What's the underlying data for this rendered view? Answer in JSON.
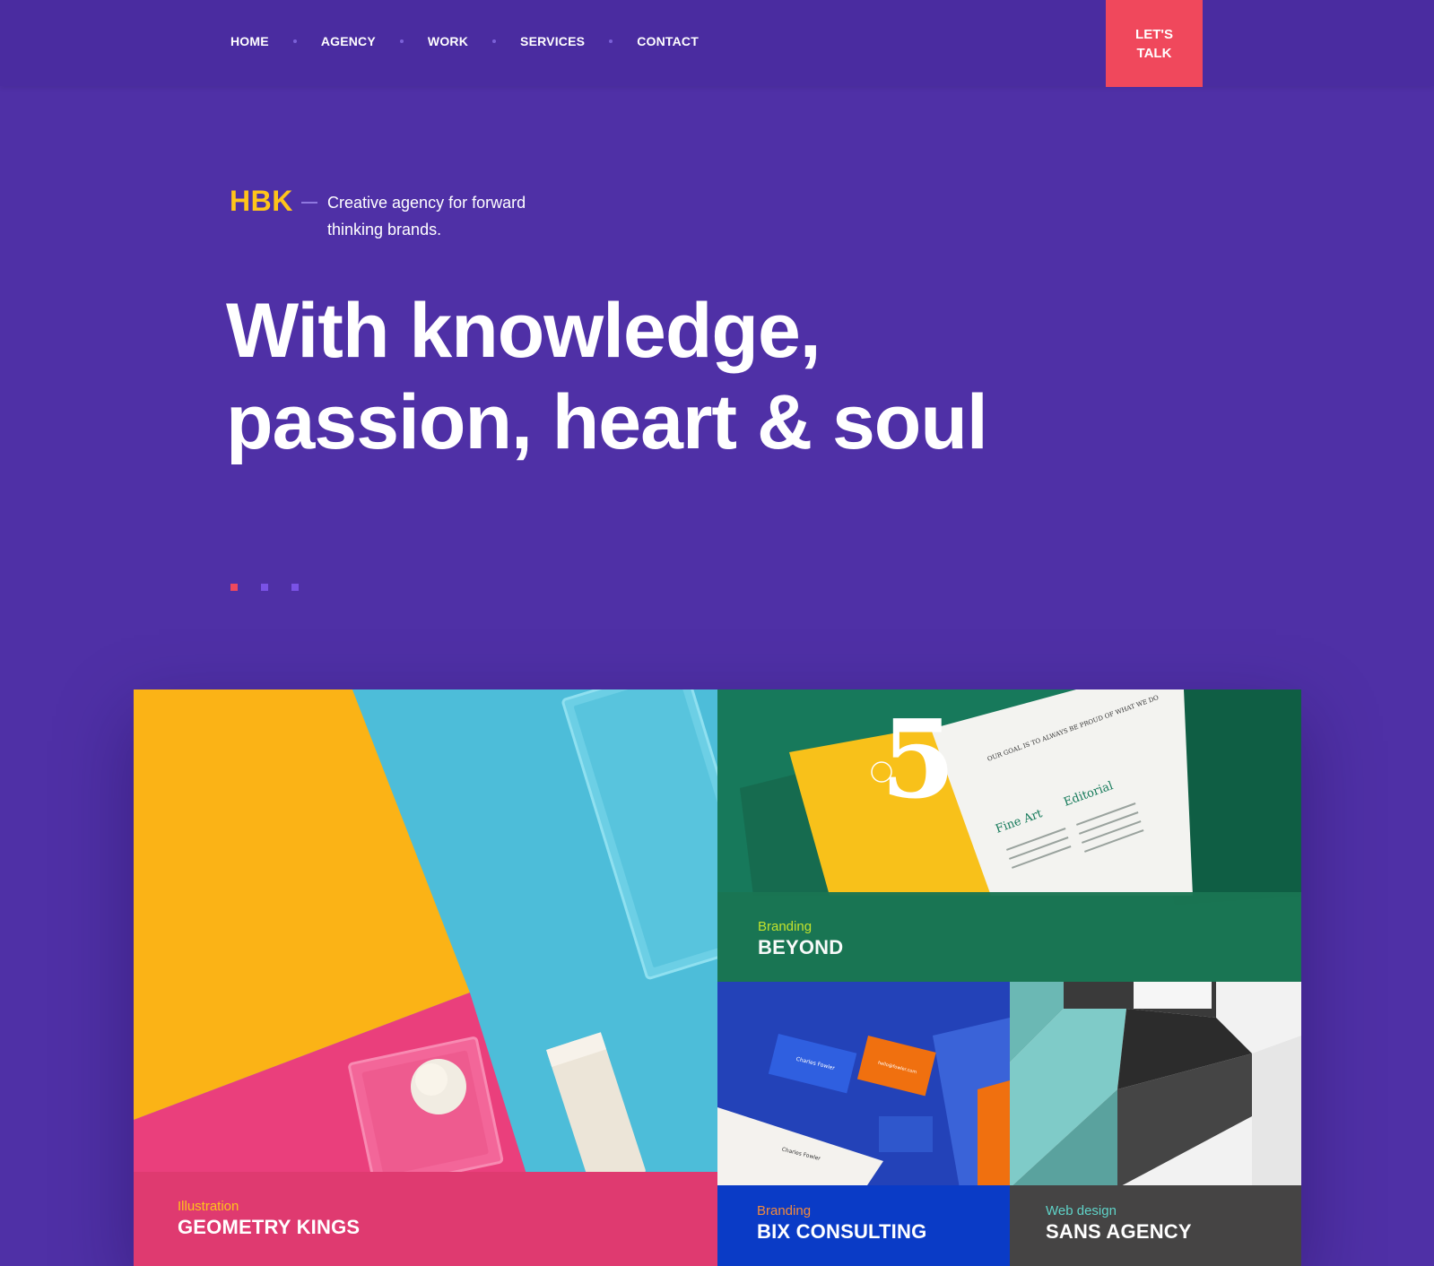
{
  "nav": {
    "items": [
      "HOME",
      "AGENCY",
      "WORK",
      "SERVICES",
      "CONTACT"
    ],
    "cta_line1": "LET'S",
    "cta_line2": "TALK"
  },
  "hero": {
    "brand": "HBK",
    "tagline": "Creative agency for forward thinking brands.",
    "headline_line1": "With knowledge,",
    "headline_line2": "passion, heart & soul",
    "slider_dots": 3,
    "active_dot": 1
  },
  "projects": [
    {
      "category": "Illustration",
      "title": "GEOMETRY KINGS"
    },
    {
      "category": "Branding",
      "title": "BEYOND"
    },
    {
      "category": "Branding",
      "title": "BIX CONSULTING"
    },
    {
      "category": "Web design",
      "title": "SANS AGENCY"
    }
  ],
  "mockup_text": {
    "book_headline": "OUR GOAL IS TO ALWAYS BE PROUD OF WHAT WE DO",
    "book_fine_art": "Fine Art",
    "book_editorial": "Editorial",
    "book_number": "5",
    "card_name": "Charles Fowler",
    "card_email": "hello@fowler.com"
  },
  "colors": {
    "background": "#4f30a6",
    "accent_red": "#f0485c",
    "brand_yellow": "#ffc41a"
  }
}
